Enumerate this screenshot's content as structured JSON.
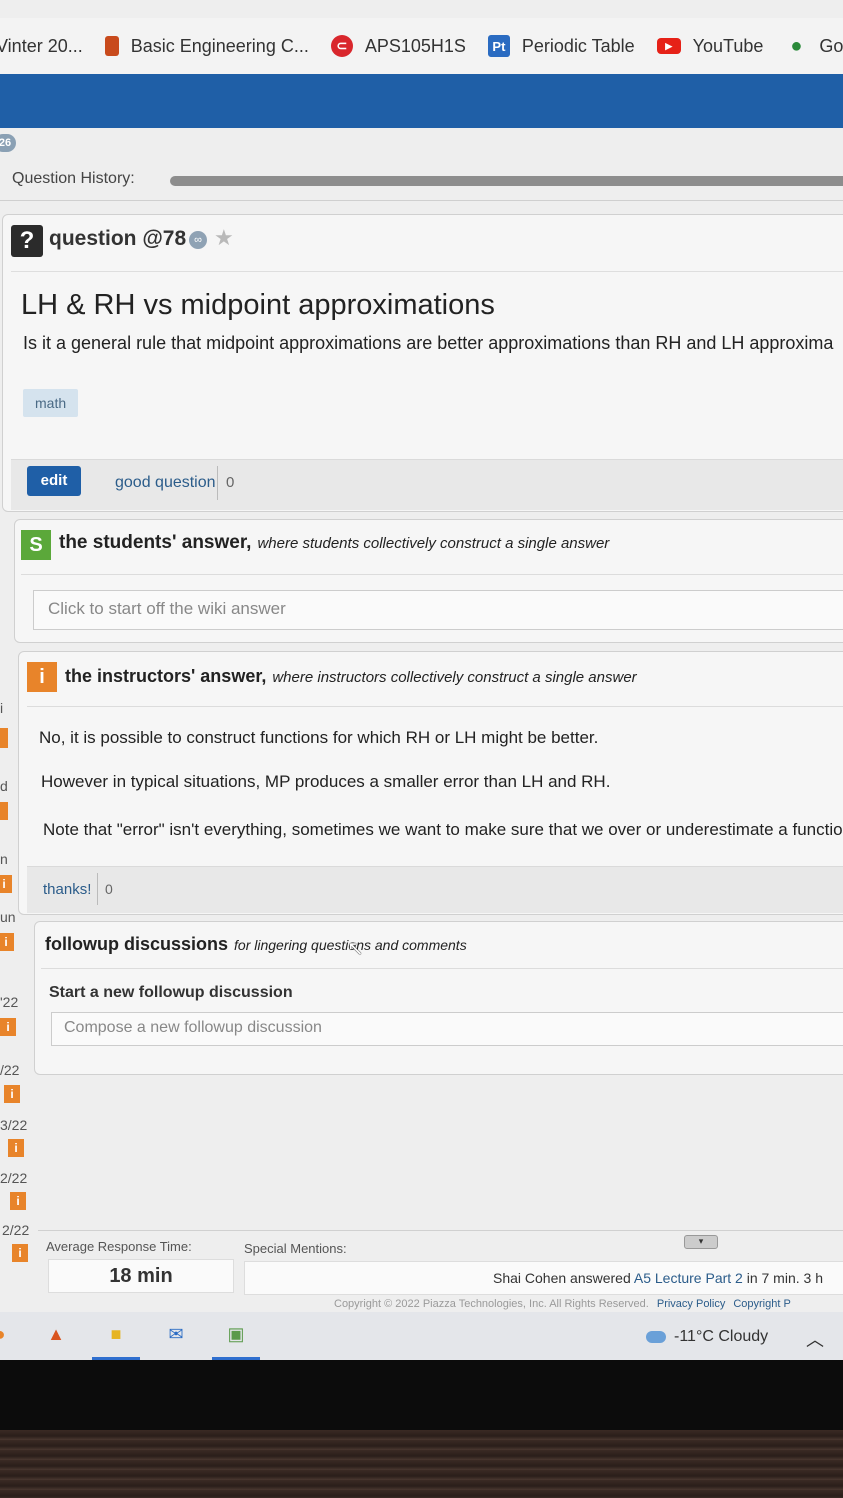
{
  "bookmarks": [
    {
      "label": "Vinter 20...",
      "icon": "none"
    },
    {
      "label": "Basic Engineering C...",
      "icon": "bookmark-icon"
    },
    {
      "label": "APS105H1S",
      "icon": "aps-icon"
    },
    {
      "label": "Periodic Table",
      "icon": "pt-icon"
    },
    {
      "label": "YouTube",
      "icon": "youtube-icon"
    },
    {
      "label": "Goog",
      "icon": "maps-pin-icon"
    }
  ],
  "feed": {
    "badge": "26",
    "marks": [
      "i",
      "d",
      "n",
      "un",
      "'22",
      "/22",
      "3/22",
      "2/22",
      "2/22"
    ]
  },
  "history": {
    "label": "Question History:"
  },
  "question": {
    "icon": "?",
    "number": "question @78",
    "title": "LH & RH vs midpoint approximations",
    "body": "Is it a general rule that midpoint approximations are better approximations than RH and LH approxima",
    "tag": "math",
    "edit_label": "edit",
    "good_label": "good question",
    "good_count": "0"
  },
  "students_answer": {
    "icon": "S",
    "title": "the students' answer,",
    "subtitle": "where students collectively construct a single answer",
    "placeholder": "Click to start off the wiki answer"
  },
  "instructors_answer": {
    "icon": "i",
    "title": "the instructors' answer,",
    "subtitle": "where instructors collectively construct a single answer",
    "paragraphs": [
      "No, it is possible to construct functions for which RH or LH might be better.",
      "However in typical situations, MP produces a smaller error than LH and RH.",
      "Note that \"error\" isn't everything, sometimes we want to make sure that we over or underestimate a functio"
    ],
    "thanks_label": "thanks!",
    "thanks_count": "0"
  },
  "followups": {
    "title": "followup discussions",
    "subtitle": "for lingering questions and comments",
    "start_label": "Start a new followup discussion",
    "placeholder": "Compose a new followup discussion"
  },
  "stats": {
    "avg_label": "Average Response Time:",
    "avg_value": "18 min",
    "mentions_label": "Special Mentions:",
    "mention_prefix": "Shai Cohen answered ",
    "mention_link": "A5 Lecture Part 2",
    "mention_suffix": " in 7 min. 3 h"
  },
  "footer": {
    "copyright": "Copyright © 2022 Piazza Technologies, Inc. All Rights Reserved.",
    "privacy": "Privacy Policy",
    "copyright_link": "Copyright P"
  },
  "taskbar": {
    "weather": "-11°C  Cloudy"
  },
  "colors": {
    "piazza_blue": "#1f5fa7",
    "students_green": "#5ba83a",
    "instructors_orange": "#e8842a"
  }
}
